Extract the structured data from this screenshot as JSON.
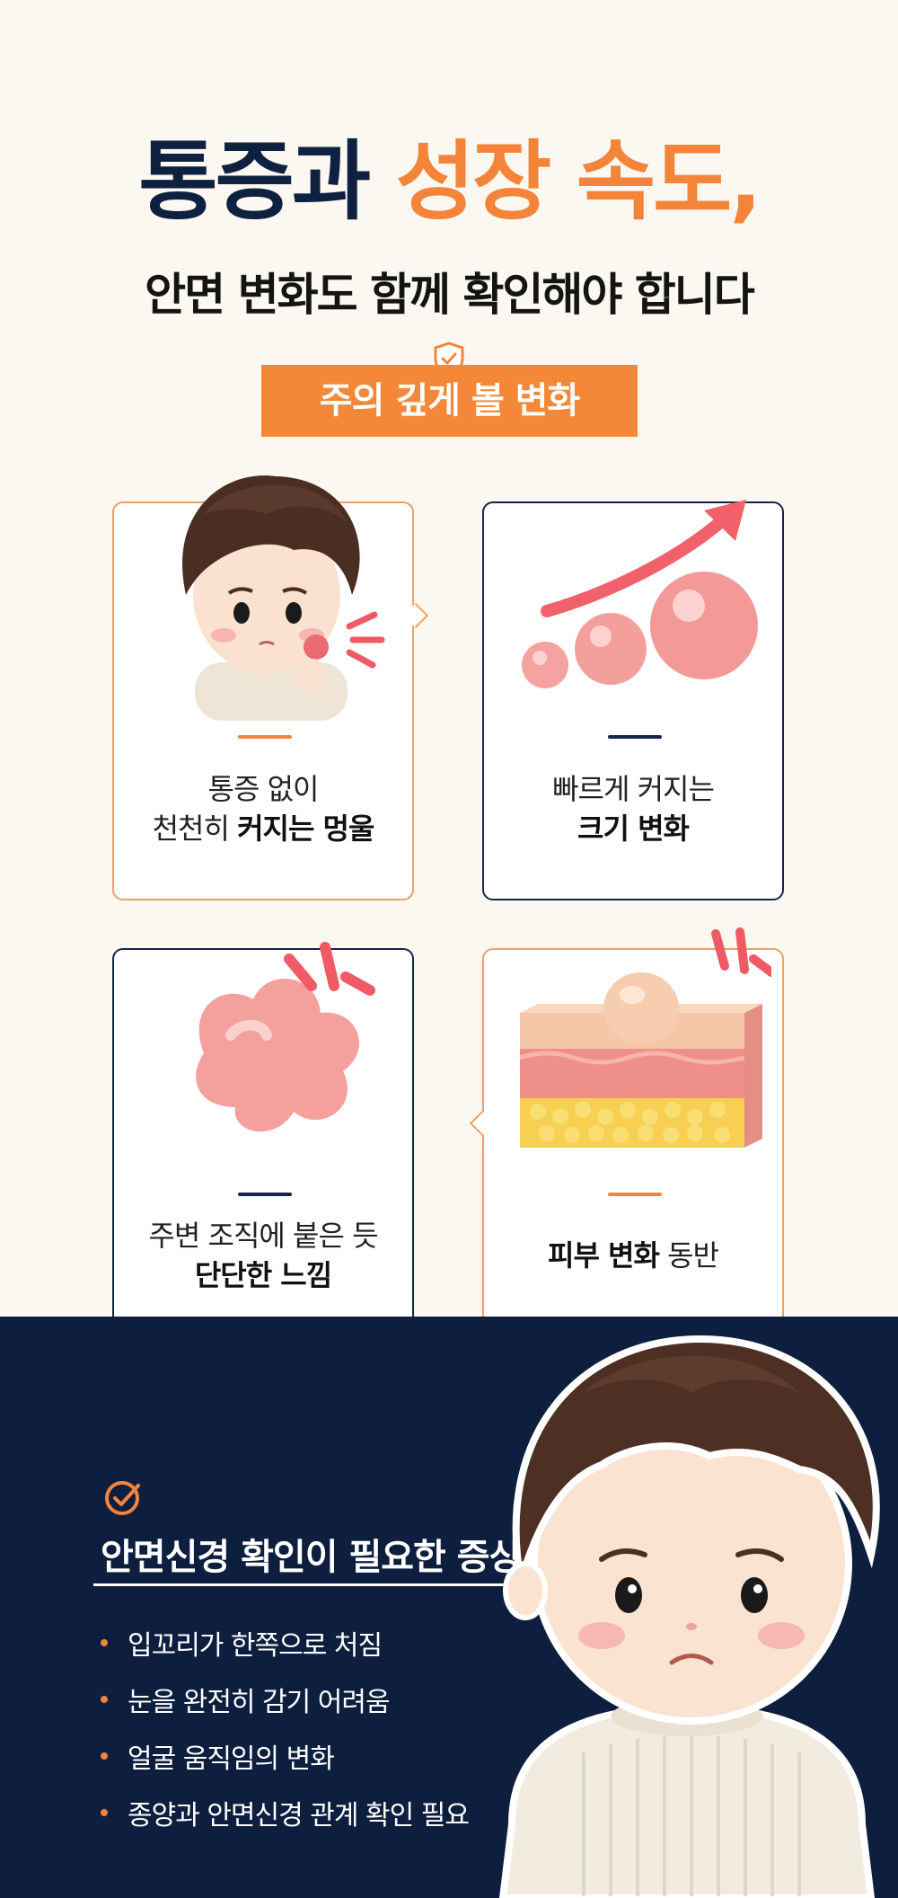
{
  "title": {
    "line1_part1": "통증과",
    "line1_part2": "성장 속도,",
    "line2": "안면 변화도 함께 확인해야 합니다"
  },
  "badge": {
    "label": "주의 깊게 볼 변화",
    "icon": "shield-check-icon"
  },
  "cards": [
    {
      "line1": "통증 없이",
      "line2_plain": "천천히 ",
      "line2_bold": "커지는 멍울",
      "art": "boy-touching-cheek-lump"
    },
    {
      "line1": "빠르게 커지는",
      "line2_plain": "",
      "line2_bold": "크기 변화",
      "art": "growing-spheres-arrow"
    },
    {
      "line1": "주변 조직에 붙은 듯",
      "line2_plain": "",
      "line2_bold": "단단한 느낌",
      "art": "firm-irregular-lump"
    },
    {
      "line1_bold": "피부 변화",
      "line1_plain": " 동반",
      "art": "skin-cross-section"
    }
  ],
  "section": {
    "icon": "check-circle-icon",
    "title": "안면신경 확인이 필요한 증상",
    "items": [
      "입꼬리가 한쪽으로 처짐",
      "눈을 완전히 감기 어려움",
      "얼굴 움직임의 변화",
      "종양과 안면신경 관계 확인 필요"
    ]
  },
  "colors": {
    "orange": "#f4843a",
    "navy": "#0d1e3e",
    "background": "#fbf8f1"
  }
}
